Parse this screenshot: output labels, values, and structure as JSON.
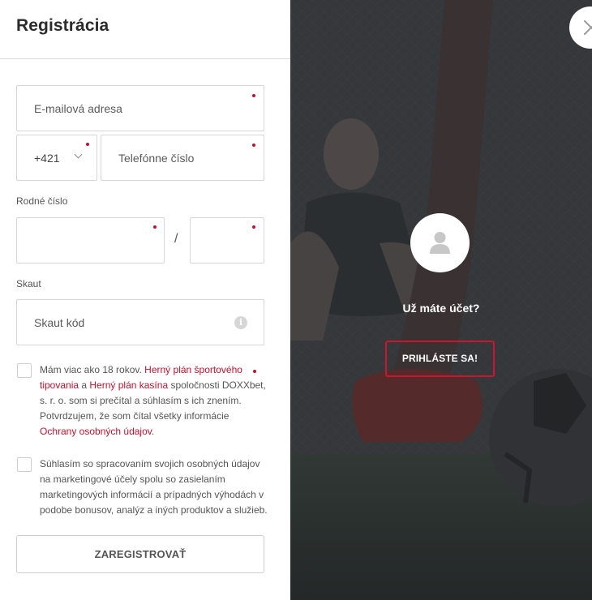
{
  "header": {
    "title": "Registrácia"
  },
  "form": {
    "email_placeholder": "E-mailová adresa",
    "phone_prefix": "+421",
    "phone_placeholder": "Telefónne číslo",
    "birth_number_label": "Rodné číslo",
    "birth_number_separator": "/",
    "scout_label": "Skaut",
    "scout_placeholder": "Skaut kód",
    "info_icon_glyph": "i",
    "consent1": {
      "text_1": "Mám viac ako 18 rokov. ",
      "link_1": "Herný plán športového tipovania",
      "text_2": " a ",
      "link_2": "Herný plán kasína",
      "text_3": " spoločnosti DOXXbet, s. r. o. som si prečítal a súhlasím s ich znením. Potvrdzujem, že som čítal všetky informácie ",
      "link_3": "Ochrany osobných údajov",
      "text_4": "."
    },
    "consent2": "Súhlasím so spracovaním svojich osobných údajov na marketingové účely spolu so zasielaním marketingových informácií a prípadných výhodách v podobe bonusov, analýz a iných produktov a služieb.",
    "register_label": "ZAREGISTROVAŤ"
  },
  "login_panel": {
    "question": "Už máte účet?",
    "login_label": "PRIHLÁSTE SA!"
  },
  "colors": {
    "accent": "#c8102e",
    "border": "#d6d6d6",
    "text": "#555555"
  },
  "icons": [
    "chevron-down-icon",
    "info-icon",
    "user-icon",
    "close-icon"
  ]
}
